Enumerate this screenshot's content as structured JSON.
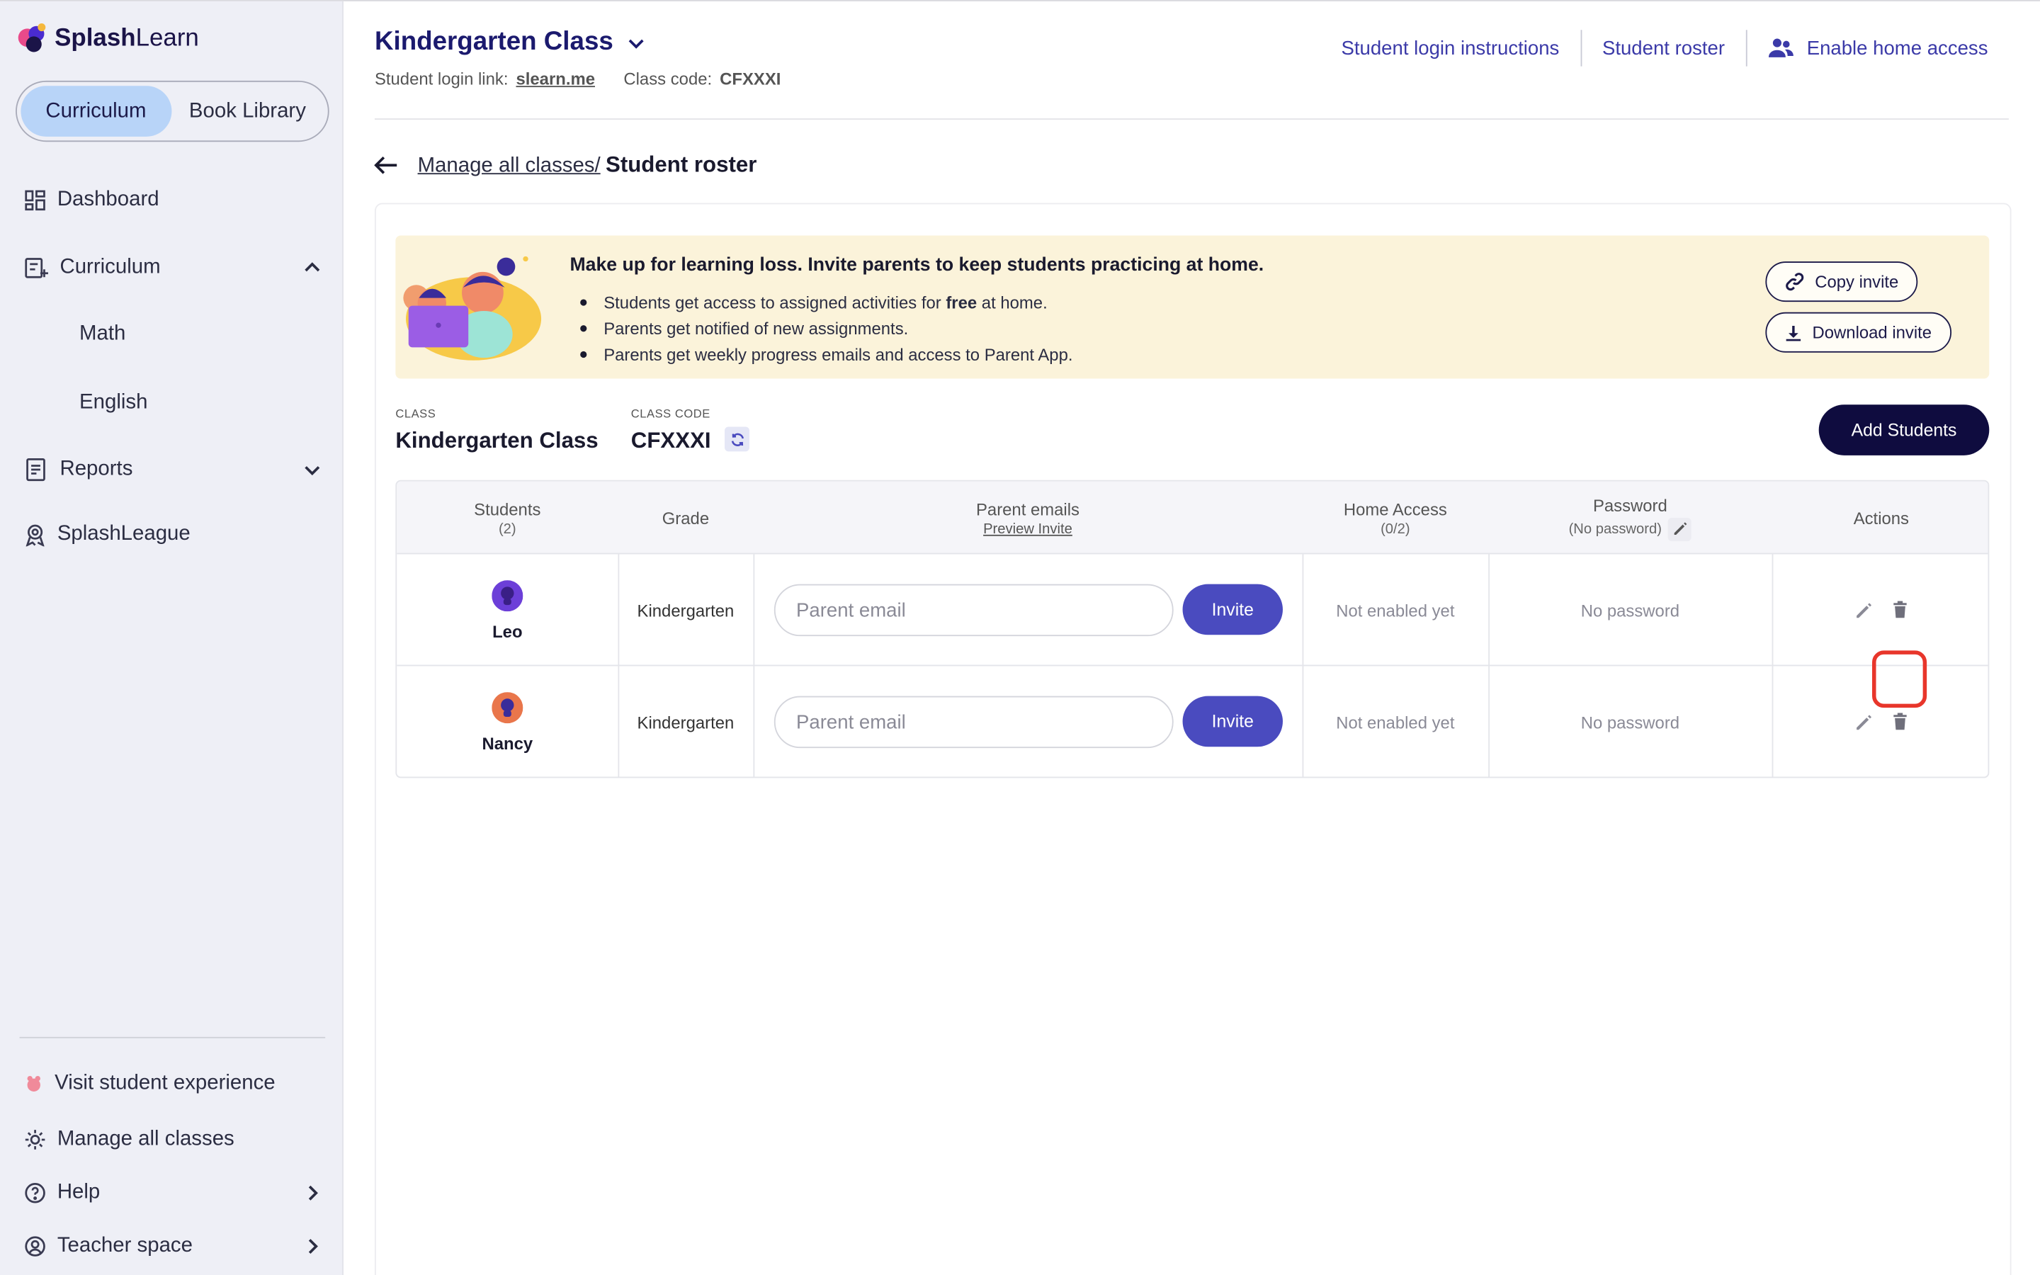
{
  "brand": {
    "name_bold": "Splash",
    "name_light": "Learn"
  },
  "sidebar": {
    "segment": {
      "active": "Curriculum",
      "inactive": "Book Library"
    },
    "items": [
      {
        "label": "Dashboard",
        "icon": "dashboard-icon"
      },
      {
        "label": "Curriculum",
        "icon": "curriculum-icon",
        "expanded": true
      },
      {
        "label": "Reports",
        "icon": "reports-icon"
      },
      {
        "label": "SplashLeague",
        "icon": "league-icon"
      }
    ],
    "curriculum_sub": [
      "Math",
      "English"
    ],
    "footer": [
      {
        "label": "Visit student experience",
        "icon": "student-icon"
      },
      {
        "label": "Manage all classes",
        "icon": "gear-icon"
      },
      {
        "label": "Help",
        "icon": "help-icon"
      },
      {
        "label": "Teacher space",
        "icon": "teacher-icon"
      }
    ]
  },
  "header": {
    "class_title": "Kindergarten Class",
    "login_label": "Student login link:",
    "login_link": "slearn.me",
    "code_label": "Class code:",
    "code_value": "CFXXXI",
    "links": [
      "Student login instructions",
      "Student roster",
      "Enable home access"
    ]
  },
  "breadcrumb": {
    "parent": "Manage all classes/",
    "current": "Student roster"
  },
  "banner": {
    "title": "Make up for learning loss. Invite parents to keep students practicing at home.",
    "bullet1_pre": "Students get access to assigned activities for ",
    "bullet1_bold": "free",
    "bullet1_post": " at home.",
    "bullet2": "Parents get notified of new assignments.",
    "bullet3": "Parents get weekly progress emails and access to Parent App.",
    "copy_invite": "Copy invite",
    "download_invite": "Download invite"
  },
  "class_info": {
    "class_label": "CLASS",
    "class_value": "Kindergarten Class",
    "code_label": "CLASS CODE",
    "code_value": "CFXXXI",
    "add_students": "Add Students"
  },
  "table": {
    "headers": {
      "students": "Students",
      "students_count": "(2)",
      "grade": "Grade",
      "parent_emails": "Parent emails",
      "preview_invite": "Preview Invite",
      "home_access": "Home Access",
      "home_access_count": "(0/2)",
      "password": "Password",
      "password_sub": "(No password)",
      "actions": "Actions"
    },
    "rows": [
      {
        "name": "Leo",
        "grade": "Kindergarten",
        "email_placeholder": "Parent email",
        "invite": "Invite",
        "home_access": "Not enabled yet",
        "password": "No password",
        "avatar_color": "#6c3fd8"
      },
      {
        "name": "Nancy",
        "grade": "Kindergarten",
        "email_placeholder": "Parent email",
        "invite": "Invite",
        "home_access": "Not enabled yet",
        "password": "No password",
        "avatar_color": "#e9764b"
      }
    ]
  },
  "colors": {
    "accent": "#4a4bbf",
    "brand_dark": "#0f0c3f",
    "highlight": "#e8362b",
    "banner_bg": "#fbf3da",
    "sidebar_bg": "#eeeff6"
  }
}
